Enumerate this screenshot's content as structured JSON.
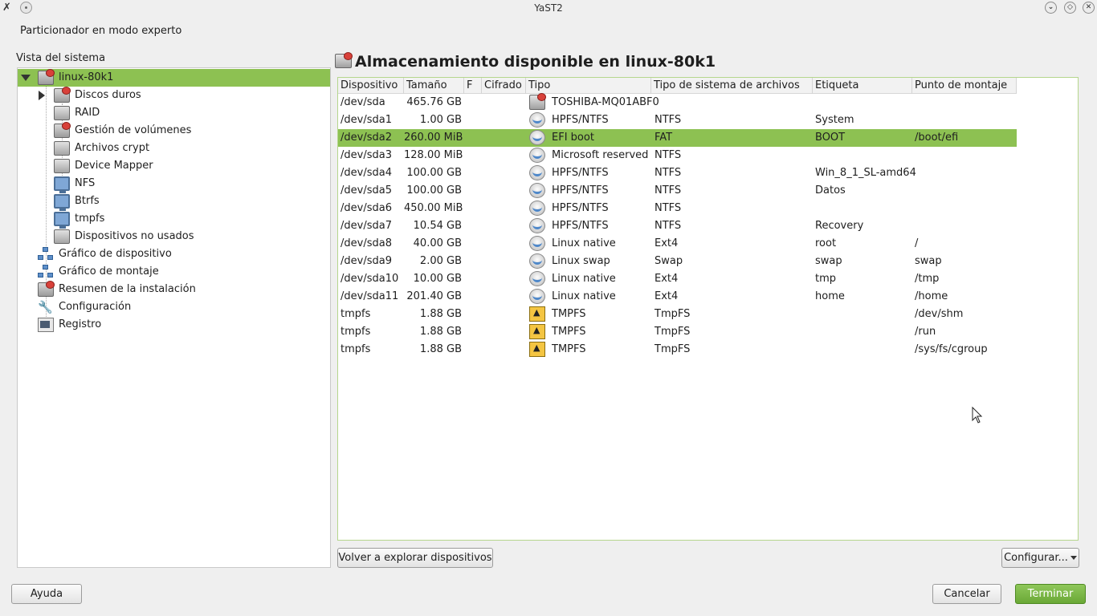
{
  "window": {
    "title": "YaST2"
  },
  "subtitle": "Particionador en modo experto",
  "tree": {
    "label": "Vista del sistema",
    "items": [
      {
        "label": "linux-80k1",
        "icon": "drive-icon"
      },
      {
        "label": "Discos duros",
        "icon": "drive-icon"
      },
      {
        "label": "RAID",
        "icon": "drive-icon"
      },
      {
        "label": "Gestión de volúmenes",
        "icon": "drive-icon"
      },
      {
        "label": "Archivos crypt",
        "icon": "crypt-icon"
      },
      {
        "label": "Device Mapper",
        "icon": "device-mapper-icon"
      },
      {
        "label": "NFS",
        "icon": "monitor-icon"
      },
      {
        "label": "Btrfs",
        "icon": "monitor-icon"
      },
      {
        "label": "tmpfs",
        "icon": "monitor-icon"
      },
      {
        "label": "Dispositivos no usados",
        "icon": "unused-devices-icon"
      },
      {
        "label": "Gráfico de dispositivo",
        "icon": "network-graph-icon"
      },
      {
        "label": "Gráfico de  montaje",
        "icon": "network-graph-icon"
      },
      {
        "label": "Resumen de la instalación",
        "icon": "drive-icon"
      },
      {
        "label": "Configuración",
        "icon": "wrench-icon"
      },
      {
        "label": "Registro",
        "icon": "log-icon"
      }
    ]
  },
  "main": {
    "title": "Almacenamiento disponible en linux-80k1",
    "columns": [
      "Dispositivo",
      "Tamaño",
      "F",
      "Cifrado",
      "Tipo",
      "Tipo de sistema de archivos",
      "Etiqueta",
      "Punto de montaje"
    ],
    "rows": [
      {
        "device": "/dev/sda",
        "size": "465.76 GB",
        "f": "",
        "enc": "",
        "type": "TOSHIBA-MQ01ABF0",
        "fs": "",
        "label": "",
        "mount": "",
        "icon": "hard-drive-icon"
      },
      {
        "device": "/dev/sda1",
        "size": "1.00 GB",
        "f": "",
        "enc": "",
        "type": "HPFS/NTFS",
        "fs": "NTFS",
        "label": "System",
        "mount": "",
        "icon": "partition-icon"
      },
      {
        "device": "/dev/sda2",
        "size": "260.00 MiB",
        "f": "",
        "enc": "",
        "type": "EFI boot",
        "fs": "FAT",
        "label": "BOOT",
        "mount": "/boot/efi",
        "icon": "partition-icon"
      },
      {
        "device": "/dev/sda3",
        "size": "128.00 MiB",
        "f": "",
        "enc": "",
        "type": "Microsoft reserved",
        "fs": "NTFS",
        "label": "",
        "mount": "",
        "icon": "partition-icon"
      },
      {
        "device": "/dev/sda4",
        "size": "100.00 GB",
        "f": "",
        "enc": "",
        "type": "HPFS/NTFS",
        "fs": "NTFS",
        "label": "Win_8_1_SL-amd64",
        "mount": "",
        "icon": "partition-icon"
      },
      {
        "device": "/dev/sda5",
        "size": "100.00 GB",
        "f": "",
        "enc": "",
        "type": "HPFS/NTFS",
        "fs": "NTFS",
        "label": "Datos",
        "mount": "",
        "icon": "partition-icon"
      },
      {
        "device": "/dev/sda6",
        "size": "450.00 MiB",
        "f": "",
        "enc": "",
        "type": "HPFS/NTFS",
        "fs": "NTFS",
        "label": "",
        "mount": "",
        "icon": "partition-icon"
      },
      {
        "device": "/dev/sda7",
        "size": "10.54 GB",
        "f": "",
        "enc": "",
        "type": "HPFS/NTFS",
        "fs": "NTFS",
        "label": "Recovery",
        "mount": "",
        "icon": "partition-icon"
      },
      {
        "device": "/dev/sda8",
        "size": "40.00 GB",
        "f": "",
        "enc": "",
        "type": "Linux native",
        "fs": "Ext4",
        "label": "root",
        "mount": "/",
        "icon": "partition-icon"
      },
      {
        "device": "/dev/sda9",
        "size": "2.00 GB",
        "f": "",
        "enc": "",
        "type": "Linux swap",
        "fs": "Swap",
        "label": "swap",
        "mount": "swap",
        "icon": "partition-icon"
      },
      {
        "device": "/dev/sda10",
        "size": "10.00 GB",
        "f": "",
        "enc": "",
        "type": "Linux native",
        "fs": "Ext4",
        "label": "tmp",
        "mount": "/tmp",
        "icon": "partition-icon"
      },
      {
        "device": "/dev/sda11",
        "size": "201.40 GB",
        "f": "",
        "enc": "",
        "type": "Linux native",
        "fs": "Ext4",
        "label": "home",
        "mount": "/home",
        "icon": "partition-icon"
      },
      {
        "device": "tmpfs",
        "size": "1.88 GB",
        "f": "",
        "enc": "",
        "type": "TMPFS",
        "fs": "TmpFS",
        "label": "",
        "mount": "/dev/shm",
        "icon": "tmpfs-icon"
      },
      {
        "device": "tmpfs",
        "size": "1.88 GB",
        "f": "",
        "enc": "",
        "type": "TMPFS",
        "fs": "TmpFS",
        "label": "",
        "mount": "/run",
        "icon": "tmpfs-icon"
      },
      {
        "device": "tmpfs",
        "size": "1.88 GB",
        "f": "",
        "enc": "",
        "type": "TMPFS",
        "fs": "TmpFS",
        "label": "",
        "mount": "/sys/fs/cgroup",
        "icon": "tmpfs-icon"
      }
    ],
    "selected_row": 2
  },
  "buttons": {
    "rescan": "Volver a explorar dispositivos",
    "configure": "Configurar...",
    "help": "Ayuda",
    "cancel": "Cancelar",
    "finish": "Terminar"
  },
  "colors": {
    "selection": "#8dc152",
    "accent": "#6aa836"
  }
}
